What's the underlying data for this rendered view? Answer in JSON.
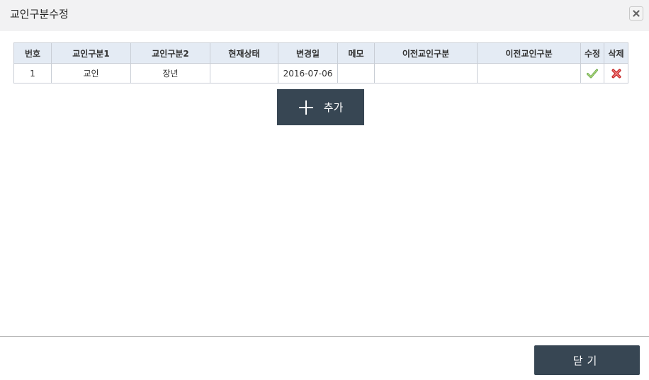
{
  "dialog": {
    "title": "교인구분수정",
    "close_icon": "close-x-icon"
  },
  "table": {
    "headers": [
      "번호",
      "교인구분1",
      "교인구분2",
      "현재상태",
      "변경일",
      "메모",
      "이전교인구분",
      "이전교인구분",
      "수정",
      "삭제"
    ],
    "rows": [
      {
        "no": "1",
        "type1": "교인",
        "type2": "장년",
        "status": "",
        "changed": "2016-07-06",
        "memo": "",
        "prev1": "",
        "prev2": "",
        "edit_icon": "check-icon",
        "delete_icon": "delete-x-icon"
      }
    ]
  },
  "add_button": {
    "label": "추가",
    "icon": "plus-icon"
  },
  "footer": {
    "close_label": "닫기"
  },
  "colors": {
    "header_bg": "#e4ebf4",
    "button_bg": "#374653",
    "check": "#8bc34a",
    "delete": "#e53935"
  }
}
